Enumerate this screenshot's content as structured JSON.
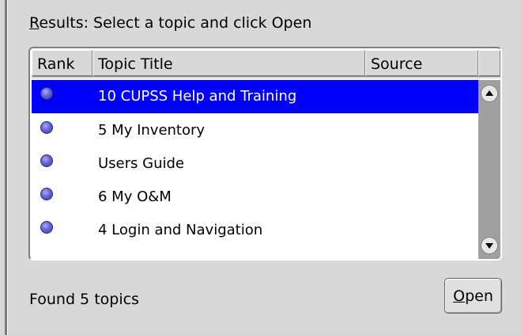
{
  "results": {
    "label_mnemonic": "R",
    "label_rest": "esults: Select a topic and click Open"
  },
  "table": {
    "columns": [
      "Rank",
      "Topic Title",
      "Source"
    ],
    "rows": [
      {
        "rank_icon": "rank-dot-icon",
        "title": "10 CUPSS Help and Training",
        "source": "",
        "selected": true
      },
      {
        "rank_icon": "rank-dot-icon",
        "title": "5 My Inventory",
        "source": "",
        "selected": false
      },
      {
        "rank_icon": "rank-dot-icon",
        "title": "Users Guide",
        "source": "",
        "selected": false
      },
      {
        "rank_icon": "rank-dot-icon",
        "title": "6 My O&M",
        "source": "",
        "selected": false
      },
      {
        "rank_icon": "rank-dot-icon",
        "title": "4 Login and Navigation",
        "source": "",
        "selected": false
      }
    ]
  },
  "status": "Found 5 topics",
  "open_button": {
    "mnemonic": "O",
    "rest": "pen"
  },
  "colors": {
    "selection": "#0000ff",
    "background": "#d8d8d8"
  }
}
